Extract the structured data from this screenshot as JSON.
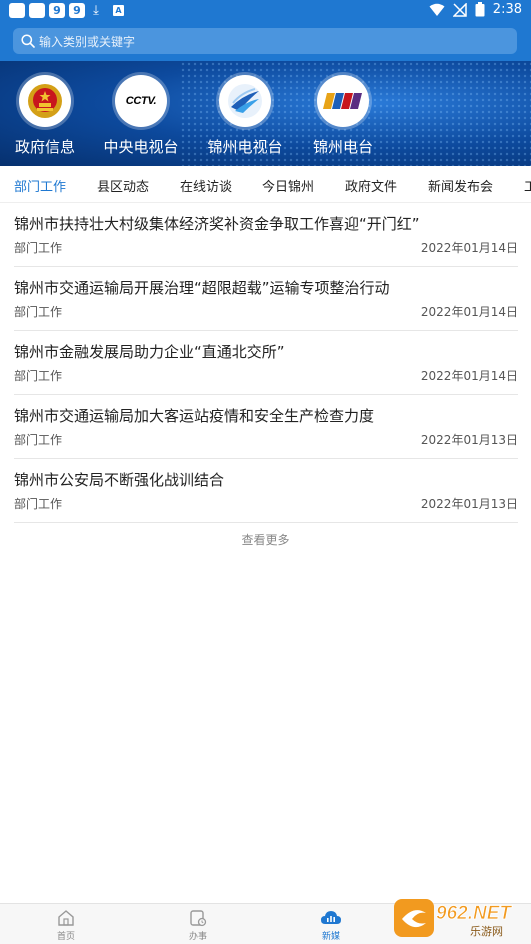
{
  "status_bar": {
    "left_icons": [
      "9",
      "9"
    ],
    "time": "2:38"
  },
  "search": {
    "placeholder": "输入类别或关键字"
  },
  "channels": [
    {
      "label": "政府信息",
      "icon": "national-emblem-icon"
    },
    {
      "label": "中央电视台",
      "icon": "cctv-logo-icon",
      "logo_text": "CCTV."
    },
    {
      "label": "锦州电视台",
      "icon": "jinzhou-tv-logo-icon"
    },
    {
      "label": "锦州电台",
      "icon": "jinzhou-radio-logo-icon"
    }
  ],
  "tabs": [
    {
      "label": "部门工作",
      "active": true
    },
    {
      "label": "县区动态"
    },
    {
      "label": "在线访谈"
    },
    {
      "label": "今日锦州"
    },
    {
      "label": "政府文件"
    },
    {
      "label": "新闻发布会"
    },
    {
      "label": "工"
    }
  ],
  "news": [
    {
      "title": "锦州市扶持壮大村级集体经济奖补资金争取工作喜迎“开门红”",
      "category": "部门工作",
      "date": "2022年01月14日"
    },
    {
      "title": "锦州市交通运输局开展治理“超限超载”运输专项整治行动",
      "category": "部门工作",
      "date": "2022年01月14日"
    },
    {
      "title": "锦州市金融发展局助力企业“直通北交所”",
      "category": "部门工作",
      "date": "2022年01月14日"
    },
    {
      "title": "锦州市交通运输局加大客运站疫情和安全生产检查力度",
      "category": "部门工作",
      "date": "2022年01月13日"
    },
    {
      "title": "锦州市公安局不断强化战训结合",
      "category": "部门工作",
      "date": "2022年01月13日"
    }
  ],
  "more_label": "查看更多",
  "bottom_nav": [
    {
      "label": "首页",
      "icon": "home-icon"
    },
    {
      "label": "办事",
      "icon": "service-icon"
    },
    {
      "label": "新媒",
      "icon": "cloud-icon",
      "active": true
    }
  ],
  "watermark": {
    "text": "962.NET",
    "sub": "乐游网"
  },
  "colors": {
    "primary": "#1f78d1",
    "banner_dark": "#06306e",
    "text": "#222222",
    "muted": "#555555"
  }
}
